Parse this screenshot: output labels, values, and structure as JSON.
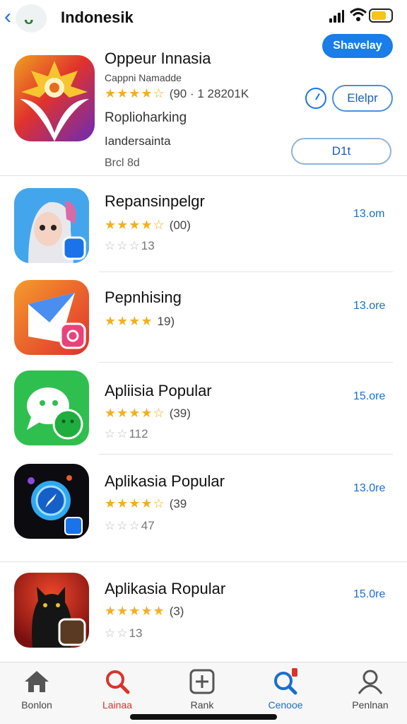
{
  "header": {
    "title": "Indonesik",
    "display_button": "Shavelay"
  },
  "featured": {
    "title": "Oppeur Innasia",
    "developer": "Cappni Namadde",
    "rating_count": "(90 · 1 28201K",
    "line1": "Roplioharking",
    "line2": "Iandersainta",
    "line3": "Brcl 8d",
    "helper_button": "Elelpr",
    "get_button": "D1t"
  },
  "apps": [
    {
      "title": "Repansinpelgr",
      "sub": "(00)",
      "meta": "13",
      "size": "13.om"
    },
    {
      "title": "Pepnhising",
      "sub": "19)",
      "meta": "",
      "size": "13.ore"
    },
    {
      "title": "Apliisia Popular",
      "sub": "(39)",
      "meta": "112",
      "size": "15.ore"
    },
    {
      "title": "Aplikasia Popular",
      "sub": "(39",
      "meta": "47",
      "size": "13.0re"
    },
    {
      "title": "Aplikasia Ropular",
      "sub": "(3)",
      "meta": "13",
      "size": "15.0re"
    }
  ],
  "tabs": [
    {
      "label": "Bonlon",
      "icon": "home-icon"
    },
    {
      "label": "Lainaa",
      "icon": "search-icon"
    },
    {
      "label": "Rank",
      "icon": "plus-square-icon"
    },
    {
      "label": "Cenooe",
      "icon": "search-badge-icon"
    },
    {
      "label": "Penlnan",
      "icon": "person-icon"
    }
  ],
  "colors": {
    "accent": "#1a7de8",
    "star": "#f2b01e",
    "active_tab": "#1a6fcc",
    "search_tab": "#d9342b"
  }
}
